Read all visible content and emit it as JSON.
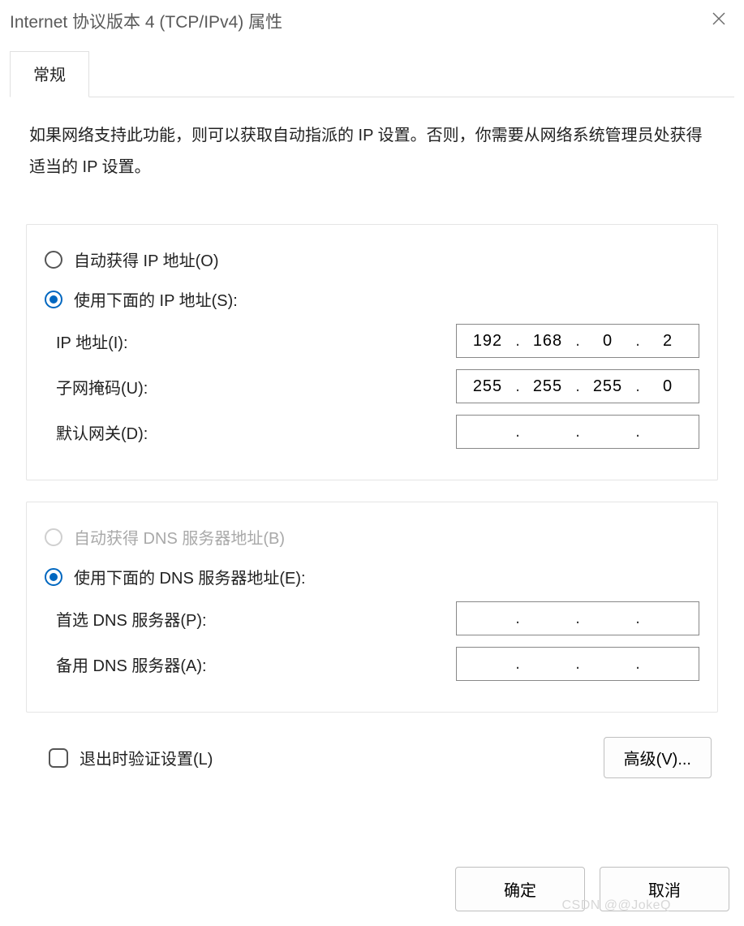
{
  "window": {
    "title": "Internet 协议版本 4 (TCP/IPv4) 属性"
  },
  "tab": {
    "general": "常规"
  },
  "intro_text": "如果网络支持此功能，则可以获取自动指派的 IP 设置。否则，你需要从网络系统管理员处获得适当的 IP 设置。",
  "ip_group": {
    "radio_auto": "自动获得 IP 地址(O)",
    "radio_manual": "使用下面的 IP 地址(S):",
    "ip_label": "IP 地址(I):",
    "ip_value": {
      "o1": "192",
      "o2": "168",
      "o3": "0",
      "o4": "2"
    },
    "mask_label": "子网掩码(U):",
    "mask_value": {
      "o1": "255",
      "o2": "255",
      "o3": "255",
      "o4": "0"
    },
    "gw_label": "默认网关(D):",
    "gw_value": {
      "o1": "",
      "o2": "",
      "o3": "",
      "o4": ""
    }
  },
  "dns_group": {
    "radio_auto": "自动获得 DNS 服务器地址(B)",
    "radio_manual": "使用下面的 DNS 服务器地址(E):",
    "pref_label": "首选 DNS 服务器(P):",
    "pref_value": {
      "o1": "",
      "o2": "",
      "o3": "",
      "o4": ""
    },
    "alt_label": "备用 DNS 服务器(A):",
    "alt_value": {
      "o1": "",
      "o2": "",
      "o3": "",
      "o4": ""
    }
  },
  "validate_label": "退出时验证设置(L)",
  "advanced_label": "高级(V)...",
  "ok_label": "确定",
  "cancel_label": "取消",
  "watermark": "CSDN @@JokeQ"
}
